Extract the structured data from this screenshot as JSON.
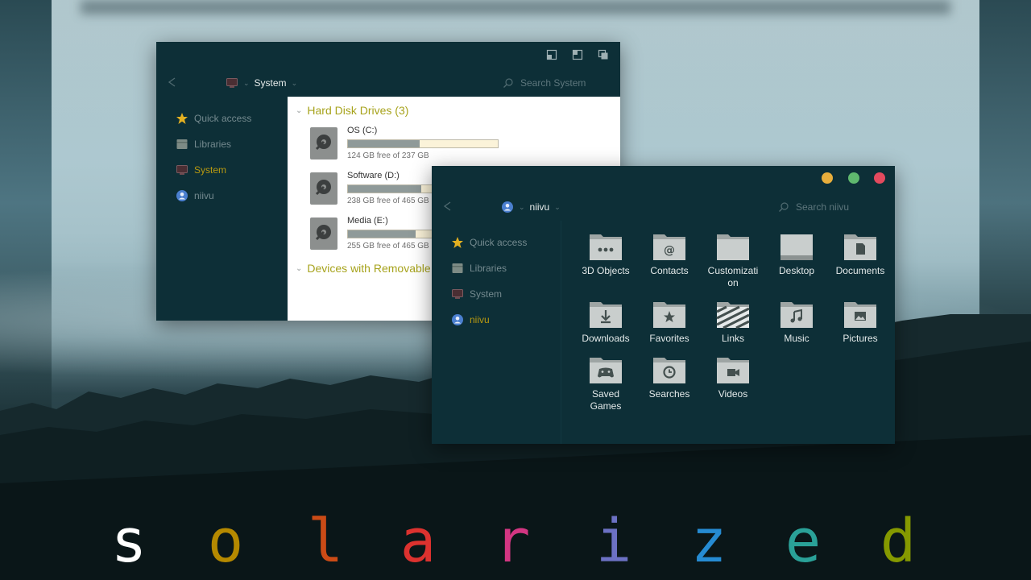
{
  "colors": {
    "window_bg": "#0d2f37",
    "accent_yellow": "#b99a10",
    "group_heading": "#a7a31c",
    "dot_minimize": "#e8ae3c",
    "dot_maximize": "#5fb86e",
    "dot_close": "#e34a5e"
  },
  "system_window": {
    "address_label": "System",
    "search_placeholder": "Search System",
    "sidebar": [
      {
        "label": "Quick access",
        "icon": "star-icon"
      },
      {
        "label": "Libraries",
        "icon": "libraries-icon"
      },
      {
        "label": "System",
        "icon": "computer-icon",
        "active": true
      },
      {
        "label": "niivu",
        "icon": "user-icon"
      }
    ],
    "groups": {
      "hard_disks": "Hard Disk Drives (3)",
      "removable": "Devices with Removable Storage"
    },
    "drives": [
      {
        "name": "OS (C:)",
        "free": "124 GB free of 237 GB",
        "used_fraction": 0.48
      },
      {
        "name": "Software (D:)",
        "free": "238 GB free of 465 GB",
        "used_fraction": 0.49
      },
      {
        "name": "Media (E:)",
        "free": "255 GB free of 465 GB",
        "used_fraction": 0.45
      }
    ]
  },
  "niivu_window": {
    "address_label": "niivu",
    "search_placeholder": "Search niivu",
    "sidebar": [
      {
        "label": "Quick access",
        "icon": "star-icon"
      },
      {
        "label": "Libraries",
        "icon": "libraries-icon"
      },
      {
        "label": "System",
        "icon": "computer-icon"
      },
      {
        "label": "niivu",
        "icon": "user-icon",
        "active": true
      }
    ],
    "folders": [
      {
        "label": "3D Objects",
        "icon": "3d-objects-folder-icon"
      },
      {
        "label": "Contacts",
        "icon": "contacts-folder-icon"
      },
      {
        "label": "Customization",
        "icon": "folder-icon"
      },
      {
        "label": "Desktop",
        "icon": "desktop-folder-icon"
      },
      {
        "label": "Documents",
        "icon": "documents-folder-icon"
      },
      {
        "label": "Downloads",
        "icon": "downloads-folder-icon"
      },
      {
        "label": "Favorites",
        "icon": "favorites-folder-icon"
      },
      {
        "label": "Links",
        "icon": "links-folder-icon"
      },
      {
        "label": "Music",
        "icon": "music-folder-icon"
      },
      {
        "label": "Pictures",
        "icon": "pictures-folder-icon"
      },
      {
        "label": "Saved Games",
        "icon": "saved-games-folder-icon"
      },
      {
        "label": "Searches",
        "icon": "searches-folder-icon"
      },
      {
        "label": "Videos",
        "icon": "videos-folder-icon"
      }
    ]
  },
  "brand": {
    "letters": [
      {
        "char": "s",
        "color": "#ffffff"
      },
      {
        "char": "o",
        "color": "#b58900"
      },
      {
        "char": "l",
        "color": "#cb4b16"
      },
      {
        "char": "a",
        "color": "#dc322f"
      },
      {
        "char": "r",
        "color": "#d33682"
      },
      {
        "char": "i",
        "color": "#6c71c4"
      },
      {
        "char": "z",
        "color": "#268bd2"
      },
      {
        "char": "e",
        "color": "#2aa198"
      },
      {
        "char": "d",
        "color": "#859900"
      }
    ]
  }
}
